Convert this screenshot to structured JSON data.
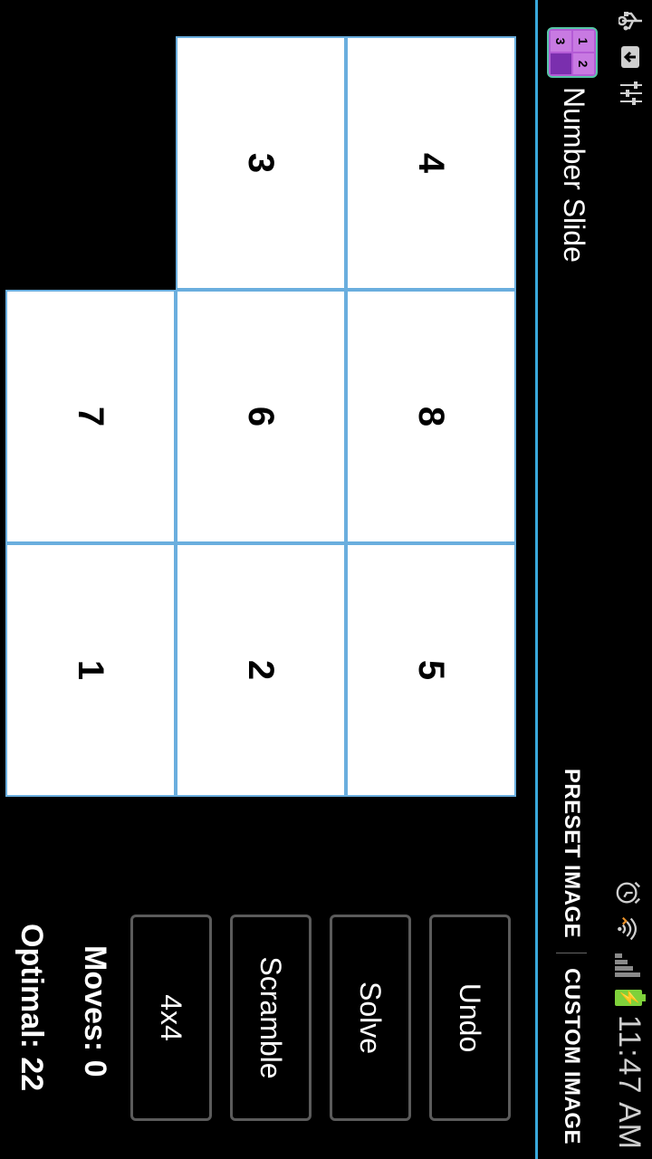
{
  "status_bar": {
    "time": "11:47 AM",
    "left_icons": [
      "usb-icon",
      "download-icon",
      "settings-sliders-icon"
    ],
    "right_icons": [
      "alarm-icon",
      "wifi-icon",
      "signal-icon",
      "battery-charging-icon"
    ]
  },
  "action_bar": {
    "app_title": "Number Slide",
    "logo_digits": [
      "1",
      "2",
      "3",
      ""
    ],
    "preset_label": "PRESET IMAGE",
    "custom_label": "CUSTOM IMAGE"
  },
  "board": {
    "rows": 3,
    "cols": 3,
    "tiles": [
      [
        "4",
        "8",
        "5"
      ],
      [
        "3",
        "6",
        "2"
      ],
      [
        "",
        "7",
        "1"
      ]
    ]
  },
  "controls": {
    "undo_label": "Undo",
    "solve_label": "Solve",
    "scramble_label": "Scramble",
    "size_label": "4x4",
    "moves_text": "Moves: 0",
    "optimal_text": "Optimal: 22"
  },
  "colors": {
    "accent": "#39a9dc",
    "tile_border": "#6aaede",
    "battery": "#7fd13b"
  }
}
